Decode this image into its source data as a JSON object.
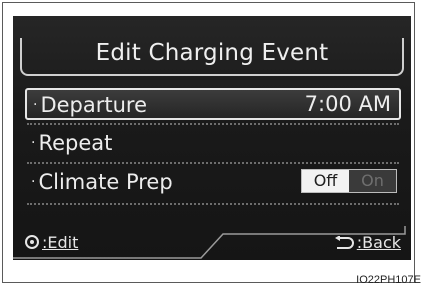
{
  "title": "Edit Charging Event",
  "items": [
    {
      "label": "Departure",
      "value": "7:00 AM",
      "selected": true
    },
    {
      "label": "Repeat",
      "value": ""
    },
    {
      "label": "Climate Prep",
      "toggle": {
        "off": "Off",
        "on": "On",
        "state": "Off"
      }
    }
  ],
  "bullet": "·",
  "footer": {
    "edit_label": ":Edit",
    "back_label": ":Back",
    "edit_icon": "dial-icon",
    "back_icon": "back-arrow-icon"
  },
  "caption": "IO22PH107E",
  "colors": {
    "screen": "#1b1b1b",
    "text": "#ededed",
    "toggle_active": "#f2f2f2",
    "toggle_inactive": "#3a3a3a"
  }
}
